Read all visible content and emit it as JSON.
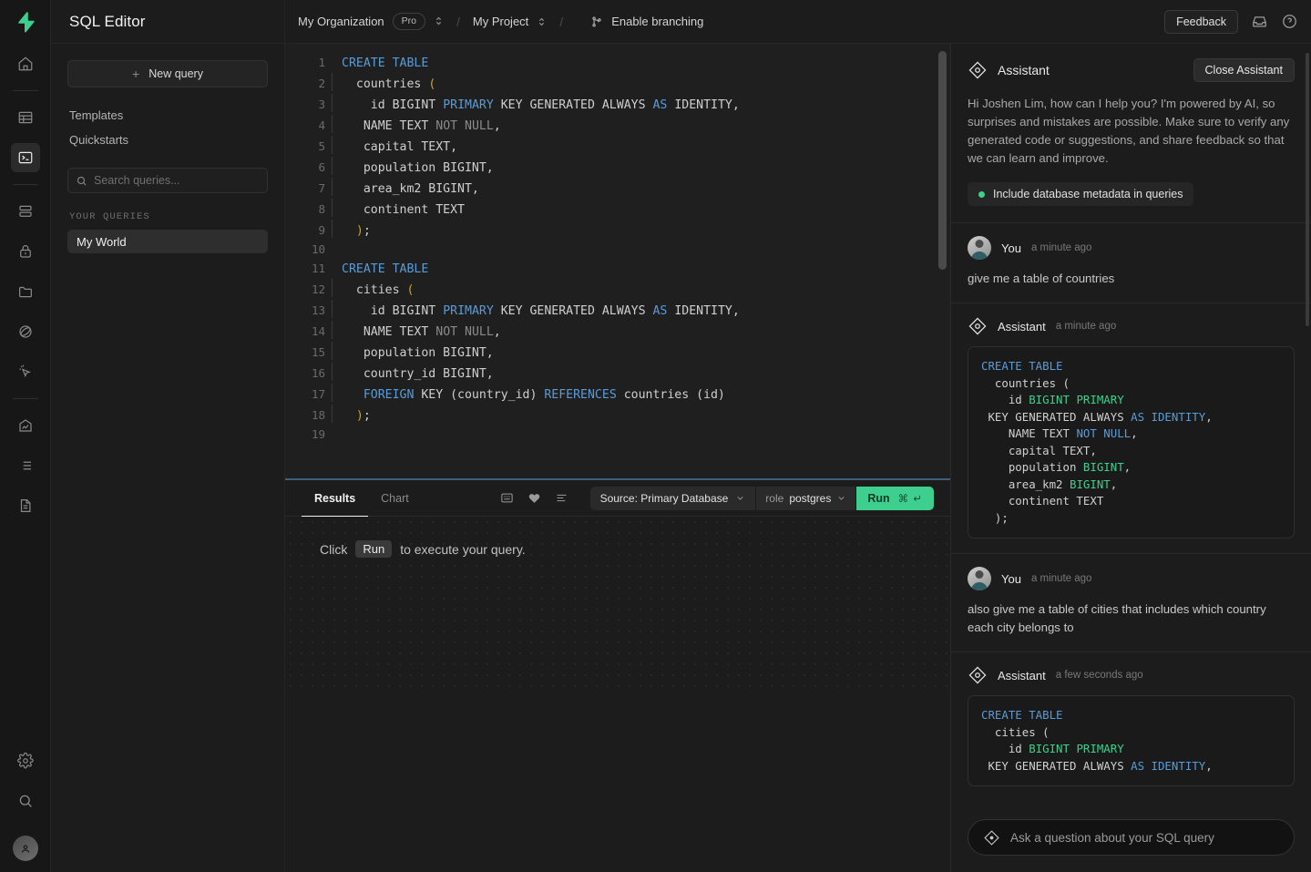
{
  "brand": {
    "logo_icon": "supabase-bolt-logo",
    "accent": "#3ecf8e"
  },
  "rail": {
    "items": [
      {
        "name": "home",
        "icon": "home-icon"
      },
      {
        "name": "table-editor",
        "icon": "table-icon"
      },
      {
        "name": "sql-editor",
        "icon": "terminal-icon",
        "active": true
      },
      {
        "name": "database",
        "icon": "database-icon"
      },
      {
        "name": "authentication",
        "icon": "lock-icon"
      },
      {
        "name": "storage",
        "icon": "folder-icon"
      },
      {
        "name": "edge-functions",
        "icon": "orbit-icon"
      },
      {
        "name": "realtime",
        "icon": "cursor-icon"
      },
      {
        "name": "reports",
        "icon": "chart-icon"
      },
      {
        "name": "logs",
        "icon": "list-icon"
      },
      {
        "name": "api-docs",
        "icon": "document-icon"
      }
    ],
    "bottom": [
      {
        "name": "settings",
        "icon": "gear-icon"
      },
      {
        "name": "search",
        "icon": "search-icon"
      }
    ],
    "avatar_icon": "user-avatar-icon"
  },
  "sidebar": {
    "title": "SQL Editor",
    "new_query_label": "New query",
    "nav": [
      {
        "label": "Templates"
      },
      {
        "label": "Quickstarts"
      }
    ],
    "search": {
      "placeholder": "Search queries...",
      "value": "",
      "icon": "search-icon"
    },
    "section_label": "YOUR QUERIES",
    "queries": [
      {
        "label": "My World",
        "active": true
      }
    ]
  },
  "topbar": {
    "organization": "My Organization",
    "plan_badge": "Pro",
    "project": "My Project",
    "branching_label": "Enable branching",
    "branch_icon": "branch-icon",
    "feedback_label": "Feedback",
    "inbox_icon": "inbox-icon",
    "help_icon": "help-circle-icon"
  },
  "editor": {
    "lines": [
      {
        "n": "1",
        "html": "<span class='kw'>CREATE TABLE</span>"
      },
      {
        "n": "2",
        "html": "<span class='guide'></span>  <span class='txt'>countries</span> <span class='pun'>(</span>"
      },
      {
        "n": "3",
        "html": "<span class='guide'></span>    <span class='txt'>id BIGINT</span> <span class='kw'>PRIMARY</span> <span class='txt'>KEY GENERATED ALWAYS</span> <span class='kw'>AS</span> <span class='txt'>IDENTITY,</span>"
      },
      {
        "n": "4",
        "html": "<span class='guide'></span>   <span class='txt'>NAME TEXT</span> <span class='dim'>NOT NULL</span><span class='txt'>,</span>"
      },
      {
        "n": "5",
        "html": "<span class='guide'></span>   <span class='txt'>capital TEXT,</span>"
      },
      {
        "n": "6",
        "html": "<span class='guide'></span>   <span class='txt'>population BIGINT,</span>"
      },
      {
        "n": "7",
        "html": "<span class='guide'></span>   <span class='txt'>area_km2 BIGINT,</span>"
      },
      {
        "n": "8",
        "html": "<span class='guide'></span>   <span class='txt'>continent TEXT</span>"
      },
      {
        "n": "9",
        "html": "<span class='guide'></span>  <span class='pun'>)</span><span class='txt'>;</span>"
      },
      {
        "n": "10",
        "html": ""
      },
      {
        "n": "11",
        "html": "<span class='kw'>CREATE TABLE</span>"
      },
      {
        "n": "12",
        "html": "<span class='guide'></span>  <span class='txt'>cities</span> <span class='pun'>(</span>"
      },
      {
        "n": "13",
        "html": "<span class='guide'></span>    <span class='txt'>id BIGINT</span> <span class='kw'>PRIMARY</span> <span class='txt'>KEY GENERATED ALWAYS</span> <span class='kw'>AS</span> <span class='txt'>IDENTITY,</span>"
      },
      {
        "n": "14",
        "html": "<span class='guide'></span>   <span class='txt'>NAME TEXT</span> <span class='dim'>NOT NULL</span><span class='txt'>,</span>"
      },
      {
        "n": "15",
        "html": "<span class='guide'></span>   <span class='txt'>population BIGINT,</span>"
      },
      {
        "n": "16",
        "html": "<span class='guide'></span>   <span class='txt'>country_id BIGINT,</span>"
      },
      {
        "n": "17",
        "html": "<span class='guide'></span>   <span class='kw'>FOREIGN</span> <span class='txt'>KEY (country_id)</span> <span class='kw'>REFERENCES</span> <span class='txt'>countries (id)</span>"
      },
      {
        "n": "18",
        "html": "<span class='guide'></span>  <span class='pun'>)</span><span class='txt'>;</span>"
      },
      {
        "n": "19",
        "html": ""
      }
    ]
  },
  "results": {
    "tabs": [
      {
        "label": "Results",
        "active": true
      },
      {
        "label": "Chart",
        "active": false
      }
    ],
    "tools": [
      {
        "name": "snippet-icon"
      },
      {
        "name": "favorite-heart-icon"
      },
      {
        "name": "format-list-icon"
      }
    ],
    "source_label": "Source: Primary Database",
    "role_prefix": "role",
    "role_value": "postgres",
    "run_label": "Run",
    "run_shortcut": "⌘ ↵",
    "empty_prefix": "Click",
    "empty_kbd": "Run",
    "empty_suffix": "to execute your query."
  },
  "assistant": {
    "title": "Assistant",
    "icon": "assistant-diamond-icon",
    "close_label": "Close Assistant",
    "intro": "Hi Joshen Lim, how can I help you? I'm powered by AI, so surprises and mistakes are possible. Make sure to verify any generated code or suggestions, and share feedback so that we can learn and improve.",
    "metadata_toggle_label": "Include database metadata in queries",
    "messages": [
      {
        "author": "You",
        "time": "a minute ago",
        "type": "text",
        "text": "give me a table of countries"
      },
      {
        "author": "Assistant",
        "time": "a minute ago",
        "type": "code",
        "code_html": "<span class='b'>CREATE TABLE</span>\n  countries (\n    id <span class='g'>BIGINT</span> <span class='g'>PRIMARY</span>\n KEY GENERATED ALWAYS <span class='b'>AS</span> <span class='b'>IDENTITY</span>,\n    NAME TEXT <span class='b'>NOT</span> <span class='b'>NULL</span>,\n    capital TEXT,\n    population <span class='g'>BIGINT</span>,\n    area_km2 <span class='g'>BIGINT</span>,\n    continent TEXT\n  );"
      },
      {
        "author": "You",
        "time": "a minute ago",
        "type": "text",
        "text": "also give me a table of cities that includes which country each city belongs to"
      },
      {
        "author": "Assistant",
        "time": "a few seconds ago",
        "type": "code",
        "code_html": "<span class='b'>CREATE TABLE</span>\n  cities (\n    id <span class='g'>BIGINT</span> <span class='g'>PRIMARY</span>\n KEY GENERATED ALWAYS <span class='b'>AS</span> <span class='b'>IDENTITY</span>,"
      }
    ],
    "input": {
      "placeholder": "Ask a question about your SQL query",
      "value": "",
      "icon": "assistant-diamond-icon"
    }
  }
}
